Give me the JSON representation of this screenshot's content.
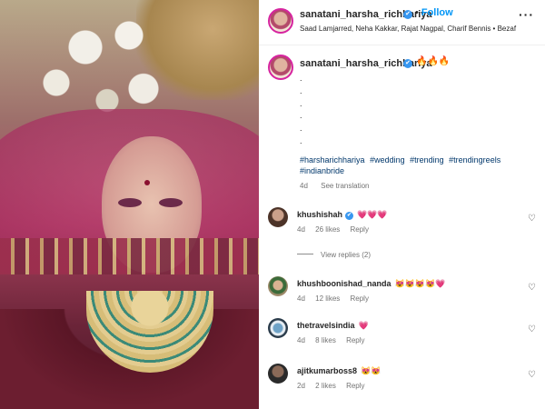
{
  "post_header": {
    "username": "sanatani_harsha_richhariya",
    "follow_label": "Follow",
    "audio_line": "Saad Lamjarred, Neha Kakkar, Rajat Nagpal, Charif Bennis • Bezaf",
    "more_label": "···"
  },
  "caption": {
    "username": "sanatani_harsha_richhariya",
    "emoji": "🔥🔥🔥",
    "dots": [
      ".",
      ".",
      ".",
      ".",
      ".",
      "."
    ],
    "hashtags": [
      "#harsharichhariya",
      "#wedding",
      "#trending",
      "#trendingreels",
      "#indianbride"
    ],
    "time": "4d",
    "see_translation": "See translation"
  },
  "comments": [
    {
      "username": "khushishah",
      "verified": true,
      "text": "💗💗💗",
      "time": "4d",
      "likes": "26 likes",
      "reply": "Reply"
    },
    {
      "username": "khushboonishad_nanda",
      "verified": false,
      "text": "😻😻😻😻💗",
      "time": "4d",
      "likes": "12 likes",
      "reply": "Reply"
    },
    {
      "username": "thetravelsindia",
      "verified": false,
      "text": "💗",
      "time": "4d",
      "likes": "8 likes",
      "reply": "Reply"
    },
    {
      "username": "ajitkumarboss8",
      "verified": false,
      "text": "😻😻",
      "time": "2d",
      "likes": "2 likes",
      "reply": "Reply"
    }
  ],
  "view_replies": "View replies (2)",
  "icons": {
    "verified": "✔",
    "heart": "♡"
  },
  "colors": {
    "link_blue": "#0095f6",
    "hashtag": "#00376b",
    "muted": "#737373"
  }
}
